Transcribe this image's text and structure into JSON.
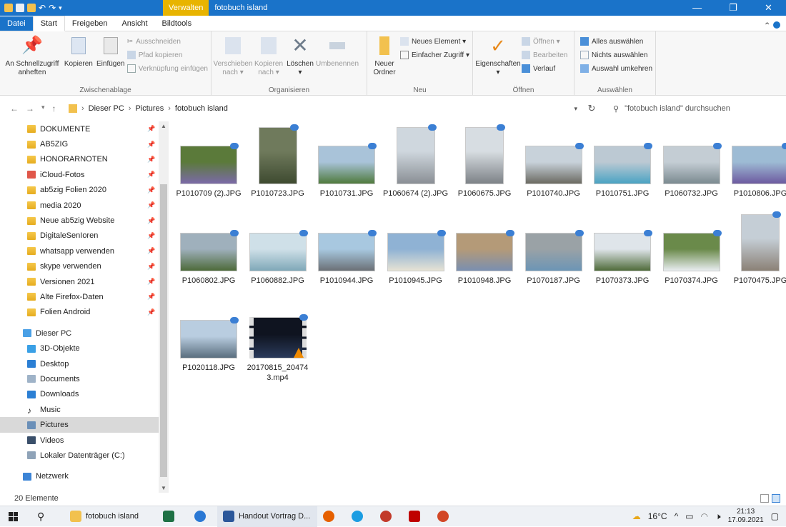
{
  "titlebar": {
    "context_tab": "Verwalten",
    "title": "fotobuch  island",
    "minimize": "—",
    "maximize": "❐",
    "close": "✕"
  },
  "ribbon_tabs": {
    "file": "Datei",
    "start": "Start",
    "share": "Freigeben",
    "view": "Ansicht",
    "picture_tools": "Bildtools",
    "collapse": "⌃"
  },
  "ribbon": {
    "clipboard": {
      "label": "Zwischenablage",
      "pin": "An Schnellzugriff\nanheften",
      "copy": "Kopieren",
      "paste": "Einfügen",
      "cut": "Ausschneiden",
      "copy_path": "Pfad kopieren",
      "paste_shortcut": "Verknüpfung einfügen"
    },
    "organize": {
      "label": "Organisieren",
      "move": "Verschieben\nnach ▾",
      "copy_to": "Kopieren\nnach ▾",
      "delete": "Löschen\n▾",
      "rename": "Umbenennen"
    },
    "new": {
      "label": "Neu",
      "new_folder": "Neuer\nOrdner",
      "new_item": "Neues Element ▾",
      "easy_access": "Einfacher Zugriff ▾"
    },
    "open": {
      "label": "Öffnen",
      "properties": "Eigenschaften\n▾",
      "open": "Öffnen ▾",
      "edit": "Bearbeiten",
      "history": "Verlauf"
    },
    "select": {
      "label": "Auswählen",
      "select_all": "Alles auswählen",
      "select_none": "Nichts auswählen",
      "invert": "Auswahl umkehren"
    }
  },
  "address": {
    "crumbs": [
      "Dieser PC",
      "Pictures",
      "fotobuch  island"
    ],
    "search_placeholder": "\"fotobuch  island\" durchsuchen"
  },
  "navpane": {
    "quick_access": [
      {
        "label": "DOKUMENTE",
        "icon": "folder-icon",
        "pinned": true
      },
      {
        "label": "AB5ZIG",
        "icon": "folder-icon",
        "pinned": true
      },
      {
        "label": "HONORARNOTEN",
        "icon": "folder-icon",
        "pinned": true
      },
      {
        "label": "iCloud-Fotos",
        "icon": "icloud-photos-icon",
        "pinned": true
      },
      {
        "label": "ab5zig Folien 2020",
        "icon": "folder-icon",
        "pinned": true
      },
      {
        "label": "media 2020",
        "icon": "folder-icon",
        "pinned": true
      },
      {
        "label": "Neue ab5zig Website",
        "icon": "folder-icon",
        "pinned": true
      },
      {
        "label": "DigitaleSenIoren",
        "icon": "folder-icon",
        "pinned": true
      },
      {
        "label": "whatsapp verwenden",
        "icon": "folder-icon",
        "pinned": true
      },
      {
        "label": "skype verwenden",
        "icon": "folder-icon",
        "pinned": true
      },
      {
        "label": "Versionen 2021",
        "icon": "folder-icon",
        "pinned": true
      },
      {
        "label": "Alte Firefox-Daten",
        "icon": "folder-icon",
        "pinned": true
      },
      {
        "label": "Folien Android",
        "icon": "folder-icon",
        "pinned": true
      }
    ],
    "this_pc": "Dieser PC",
    "pc_items": [
      {
        "label": "3D-Objekte",
        "icon": "3d-objects-icon"
      },
      {
        "label": "Desktop",
        "icon": "desktop-icon"
      },
      {
        "label": "Documents",
        "icon": "documents-icon"
      },
      {
        "label": "Downloads",
        "icon": "downloads-icon"
      },
      {
        "label": "Music",
        "icon": "music-icon"
      },
      {
        "label": "Pictures",
        "icon": "pictures-icon",
        "selected": true
      },
      {
        "label": "Videos",
        "icon": "videos-icon"
      },
      {
        "label": "Lokaler Datenträger (C:)",
        "icon": "drive-icon"
      }
    ],
    "network": "Netzwerk"
  },
  "files": [
    {
      "name": "P1010709 (2).JPG",
      "type": "image",
      "c1": "#5b7a3a",
      "c2": "#7b6aa8"
    },
    {
      "name": "P1010723.JPG",
      "type": "image",
      "c1": "#6f7a5c",
      "c2": "#3e4a30",
      "portrait": true
    },
    {
      "name": "P1010731.JPG",
      "type": "image",
      "c1": "#a9c3d9",
      "c2": "#4f7a3d"
    },
    {
      "name": "P1060674 (2).JPG",
      "type": "image",
      "c1": "#cfd7de",
      "c2": "#8a8f95",
      "portrait": true
    },
    {
      "name": "P1060675.JPG",
      "type": "image",
      "c1": "#d7dde2",
      "c2": "#7d8287",
      "portrait": true
    },
    {
      "name": "P1010740.JPG",
      "type": "image",
      "c1": "#c8d2da",
      "c2": "#6b6a62"
    },
    {
      "name": "P1010751.JPG",
      "type": "image",
      "c1": "#bcc9d3",
      "c2": "#4aa3c3"
    },
    {
      "name": "P1060732.JPG",
      "type": "image",
      "c1": "#c4cdd4",
      "c2": "#7b8a90"
    },
    {
      "name": "P1010806.JPG",
      "type": "image",
      "c1": "#9dbbd4",
      "c2": "#6d5aa0"
    },
    {
      "name": "P1060802.JPG",
      "type": "image",
      "c1": "#9fb0bc",
      "c2": "#4d6a3a"
    },
    {
      "name": "P1060882.JPG",
      "type": "image",
      "c1": "#cfe0e8",
      "c2": "#7fa8b8"
    },
    {
      "name": "P1010944.JPG",
      "type": "image",
      "c1": "#a8c8e0",
      "c2": "#6b7076"
    },
    {
      "name": "P1010945.JPG",
      "type": "image",
      "c1": "#8fb2d4",
      "c2": "#e6e2d4"
    },
    {
      "name": "P1010948.JPG",
      "type": "image",
      "c1": "#b49a78",
      "c2": "#7a8fb0"
    },
    {
      "name": "P1070187.JPG",
      "type": "image",
      "c1": "#9aa2a6",
      "c2": "#6c95b5"
    },
    {
      "name": "P1070373.JPG",
      "type": "image",
      "c1": "#dfe5ea",
      "c2": "#4f6b3a"
    },
    {
      "name": "P1070374.JPG",
      "type": "image",
      "c1": "#6a8a4a",
      "c2": "#e8edf0"
    },
    {
      "name": "P1070475.JPG",
      "type": "image",
      "c1": "#c5ced6",
      "c2": "#8b8176",
      "portrait": true
    },
    {
      "name": "P1020118.JPG",
      "type": "image",
      "c1": "#b9cde0",
      "c2": "#5a6e7e"
    },
    {
      "name": "20170815_20474\n3.mp4",
      "type": "video",
      "c1": "#0f1420",
      "c2": "#2a3a5a"
    }
  ],
  "statusbar": {
    "count": "20 Elemente"
  },
  "taskbar": {
    "explorer_label": "fotobuch  island",
    "word_label": "Handout Vortrag D...",
    "temperature": "16°C",
    "time": "21:13",
    "date": "17.09.2021"
  },
  "colors": {
    "accent": "#1a73c9",
    "context_tab": "#e8b400",
    "selection": "#d9d9d9"
  }
}
